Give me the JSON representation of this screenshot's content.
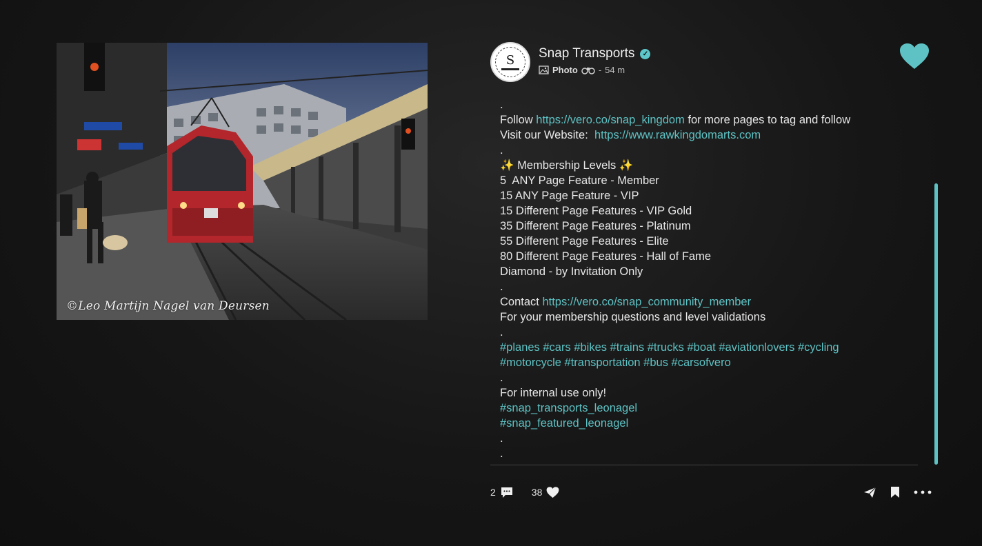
{
  "post": {
    "watermark": "©Leo Martijn Nagel van Deursen",
    "account": {
      "name": "Snap Transports",
      "avatar_letter": "S",
      "avatar_label": "snap",
      "verified": true
    },
    "meta": {
      "type": "Photo",
      "separator": "-",
      "time": "54 m"
    },
    "accent_color": "#5ec2c4",
    "caption": {
      "l0": ".",
      "l1_pre": "Follow ",
      "l1_link": "https://vero.co/snap_kingdom",
      "l1_post": " for more pages to tag and follow",
      "l2_pre": "Visit our Website:  ",
      "l2_link": "https://www.rawkingdomarts.com",
      "l3": ".",
      "l4": "✨ Membership Levels ✨",
      "l5": "5  ANY Page Feature - Member",
      "l6": "15 ANY Page Feature - VIP",
      "l7": "15 Different Page Features - VIP Gold",
      "l8": "35 Different Page Features - Platinum",
      "l9": "55 Different Page Features - Elite",
      "l10": "80 Different Page Features - Hall of Fame",
      "l11": "Diamond - by Invitation Only",
      "l12": ".",
      "l13_pre": "Contact ",
      "l13_link": "https://vero.co/snap_community_member",
      "l14": "For your membership questions and level validations",
      "l15": ".",
      "l16_tags": "#planes #cars #bikes #trains #trucks #boat #aviationlovers #cycling",
      "l17_tags": "#motorcycle #transportation #bus #carsofvero",
      "l18": ".",
      "l19": "For internal use only!",
      "l20_tag": "#snap_transports_leonagel",
      "l21_tag": "#snap_featured_leonagel",
      "l22": ".",
      "l23": "."
    },
    "stats": {
      "comments": "2",
      "likes": "38"
    }
  }
}
